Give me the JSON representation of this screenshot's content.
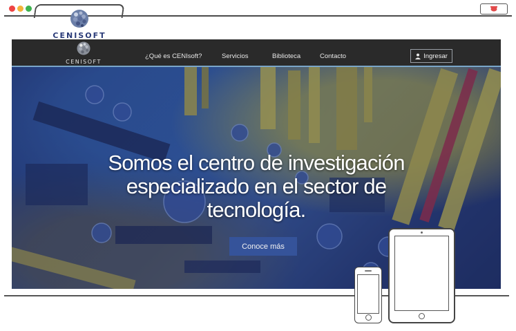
{
  "browser": {
    "window_controls": [
      "close",
      "minimize",
      "maximize"
    ],
    "brand_name": "CENISOFT",
    "extension_icon": "bug-icon"
  },
  "nav": {
    "logo_text": "CENISOFT",
    "links": [
      "¿Qué es CENIsoft?",
      "Servicios",
      "Biblioteca",
      "Contacto"
    ],
    "login_label": "Ingresar",
    "login_icon": "user-icon"
  },
  "hero": {
    "headline_lines": [
      "Somos el centro de investigación",
      "especializado en el sector de",
      "tecnología."
    ],
    "cta_label": "Conoce más"
  },
  "devices": {
    "phone": "phone-outline",
    "tablet": "tablet-outline"
  },
  "colors": {
    "nav_bg": "#2a2a2a",
    "cta_bg": "#35539a",
    "brand": "#2a3b78",
    "hero_tint": "#2a3f80"
  }
}
